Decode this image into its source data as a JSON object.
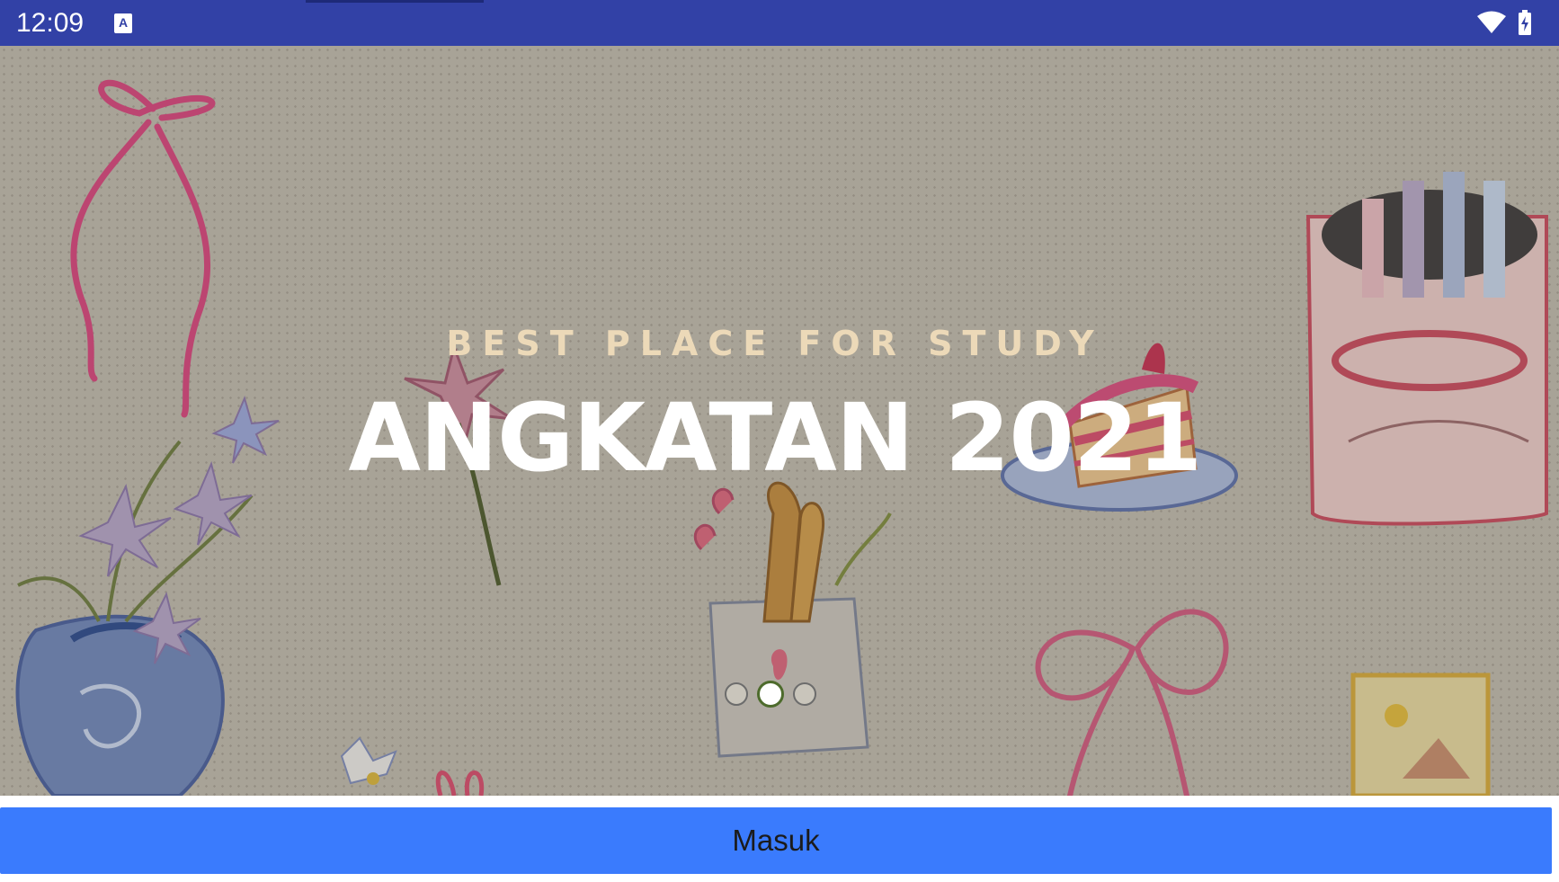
{
  "status_bar": {
    "time": "12:09",
    "notification_icon": "keyboard-a-icon",
    "notification_glyph": "A",
    "wifi_icon": "wifi-icon",
    "battery_icon": "battery-charging-icon",
    "background": "#3241a6"
  },
  "hero": {
    "subtitle": "BEST PLACE FOR STUDY",
    "title": "ANGKATAN 2021",
    "background_image": "hand-drawn doodles illustration",
    "subtitle_color": "#ecd9b8",
    "title_color": "#ffffff"
  },
  "pager": {
    "count": 3,
    "active_index": 1
  },
  "login": {
    "label": "Masuk",
    "color": "#3a7bfd"
  }
}
